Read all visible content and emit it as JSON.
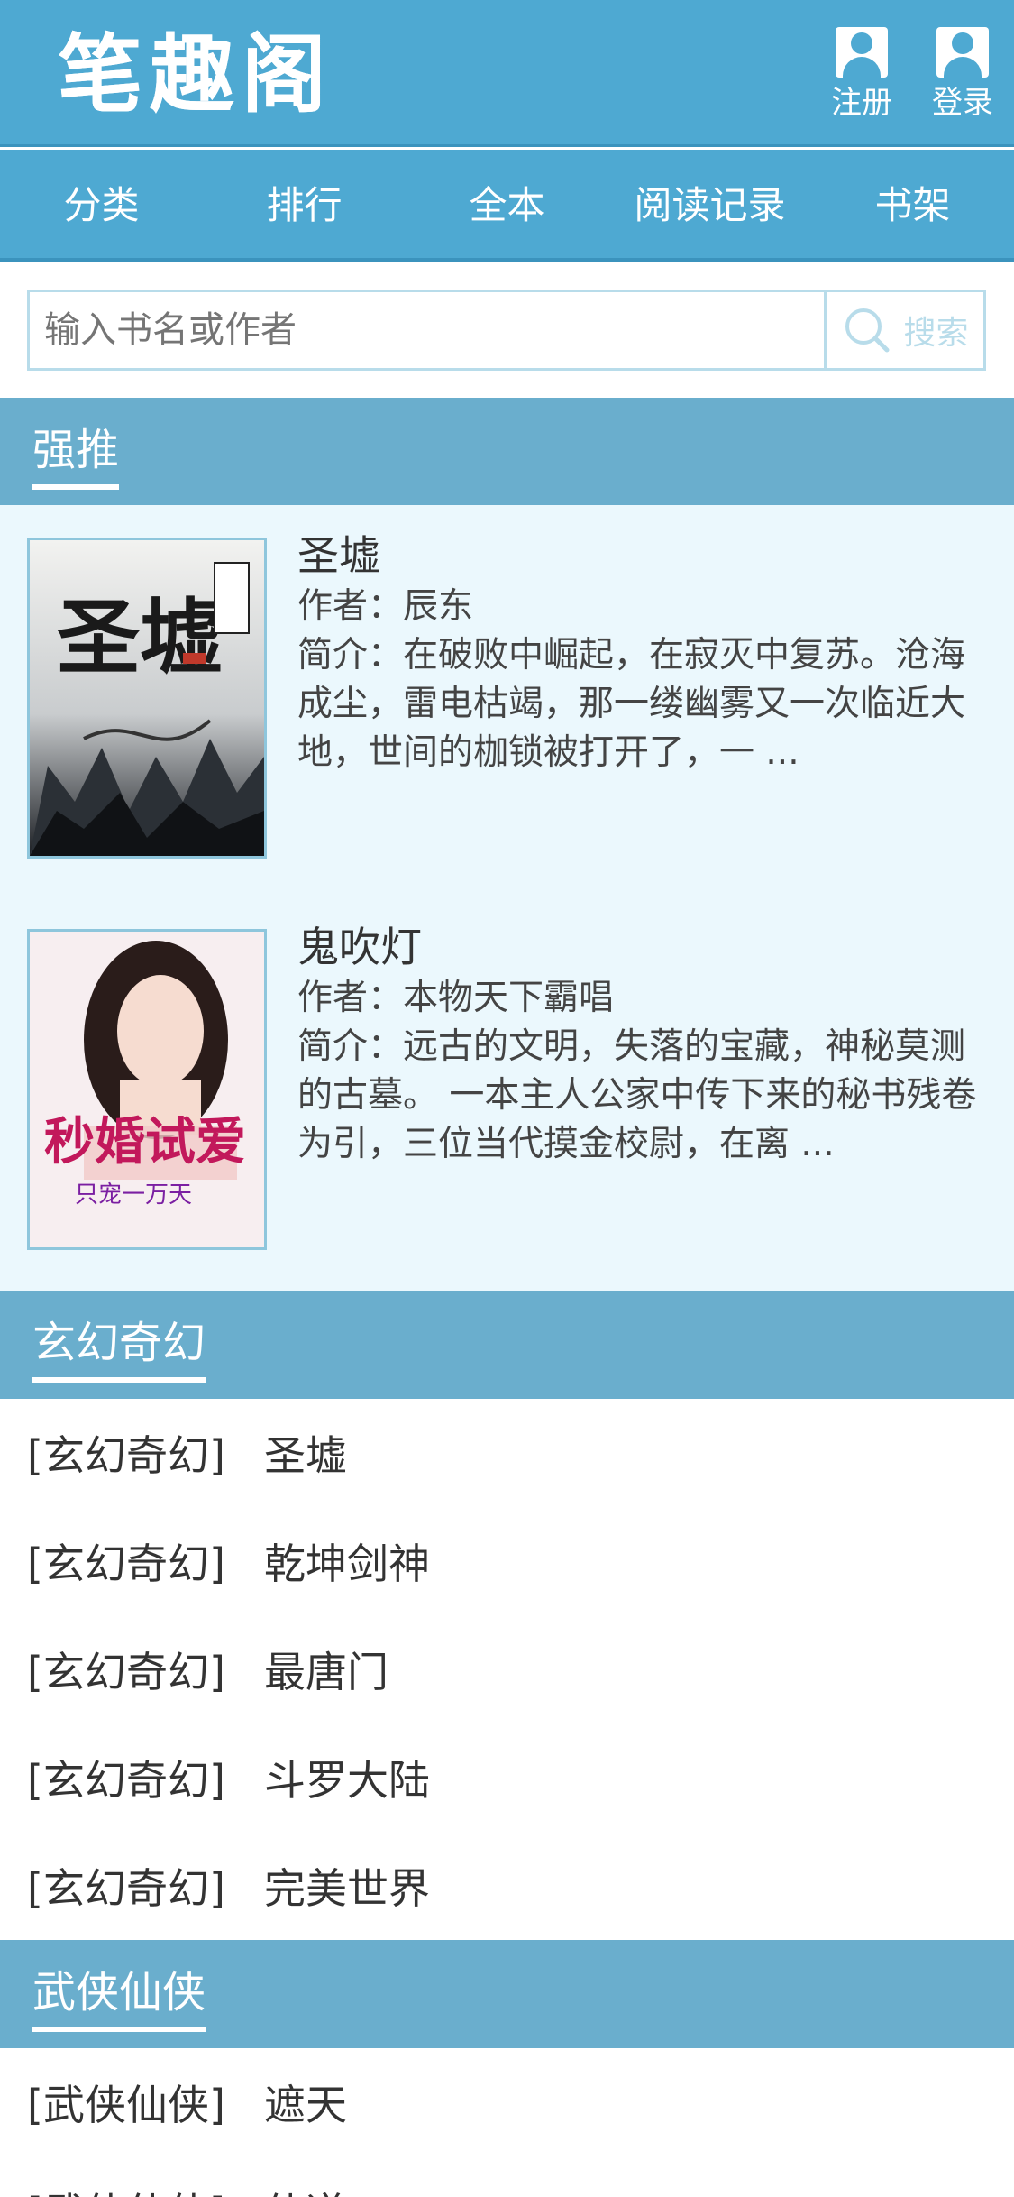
{
  "header": {
    "logo": "笔趣阁",
    "register_label": "注册",
    "login_label": "登录"
  },
  "nav": [
    "分类",
    "排行",
    "全本",
    "阅读记录",
    "书架"
  ],
  "search": {
    "placeholder": "输入书名或作者",
    "button_label": "搜索"
  },
  "recommend": {
    "title": "强推",
    "books": [
      {
        "title": "圣墟",
        "author": "作者：辰东",
        "desc": "简介：在破败中崛起，在寂灭中复苏。沧海成尘，雷电枯竭，那一缕幽雾又一次临近大地，世间的枷锁被打开了，一 ...",
        "cover_text": "圣墟"
      },
      {
        "title": "鬼吹灯",
        "author": "作者：本物天下霸唱",
        "desc": "简介：远古的文明，失落的宝藏，神秘莫测的古墓。 一本主人公家中传下来的秘书残卷为引，三位当代摸金校尉，在离 ...",
        "cover_text": "秒婚试爱",
        "cover_subtext": "只宠一万天"
      }
    ]
  },
  "sections": [
    {
      "title": "玄幻奇幻",
      "items": [
        {
          "category": "[玄幻奇幻]",
          "name": "圣墟"
        },
        {
          "category": "[玄幻奇幻]",
          "name": "乾坤剑神"
        },
        {
          "category": "[玄幻奇幻]",
          "name": "最唐门"
        },
        {
          "category": "[玄幻奇幻]",
          "name": "斗罗大陆"
        },
        {
          "category": "[玄幻奇幻]",
          "name": "完美世界"
        }
      ]
    },
    {
      "title": "武侠仙侠",
      "items": [
        {
          "category": "[武侠仙侠]",
          "name": "遮天"
        },
        {
          "category": "[武侠仙侠]",
          "name": "仙道"
        }
      ]
    }
  ]
}
